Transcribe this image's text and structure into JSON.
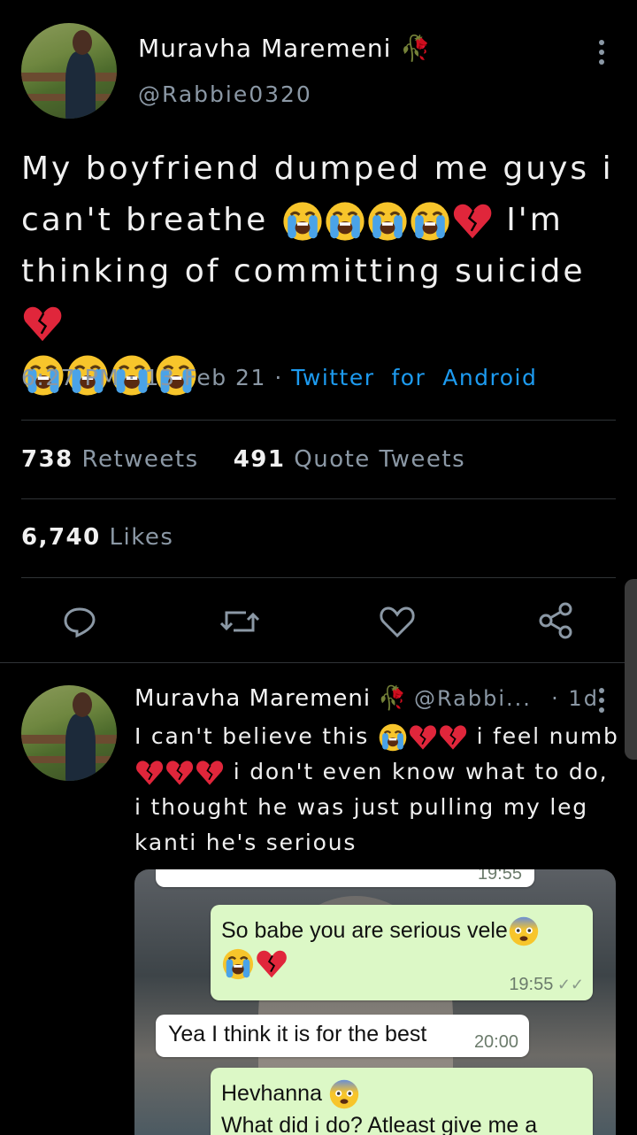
{
  "tweet": {
    "author_name": "Muravha Maremeni",
    "author_handle": "@Rabbie0320",
    "text_line1": "My boyfriend dumped me guys i",
    "text_line2_a": "can't breathe",
    "text_line2_b": "I'm",
    "text_line3": "thinking of committing suicide",
    "time": "6:27 PM",
    "date": "13 Feb 21",
    "source_a": "Twitter",
    "source_b": "for",
    "source_c": "Android",
    "retweets_count": "738",
    "retweets_label": "Retweets",
    "quotes_count": "491",
    "quotes_label": "Quote Tweets",
    "likes_count": "6,740",
    "likes_label": "Likes"
  },
  "reply": {
    "author_name": "Muravha Maremeni",
    "author_handle": "@Rabbi...",
    "age": "· 1d",
    "line1_a": "I can't believe this",
    "line1_b": "i feel numb",
    "line2": "i don't even know what to do,",
    "line3": "i thought he was just pulling my leg",
    "line4": "kanti he's serious"
  },
  "chat": {
    "top_time": "19:55",
    "msg1_text": "So babe you are serious vele",
    "msg1_time": "19:55",
    "msg2_text": "Yea I think it is for the best",
    "msg2_time": "20:00",
    "msg3_line1": "Hevhanna",
    "msg3_line2": "What did i do? Atleast give me a"
  },
  "colors": {
    "background": "#000000",
    "link": "#1d9bf0",
    "muted": "#8b98a5",
    "divider": "#2f3336",
    "outgoing_bubble": "#dcf8c6"
  },
  "icons": [
    "rose-icon",
    "more-vertical-icon",
    "reply-icon",
    "retweet-icon",
    "like-icon",
    "share-icon",
    "loudly-crying-face-icon",
    "broken-heart-icon",
    "fearful-face-icon",
    "double-check-icon"
  ]
}
